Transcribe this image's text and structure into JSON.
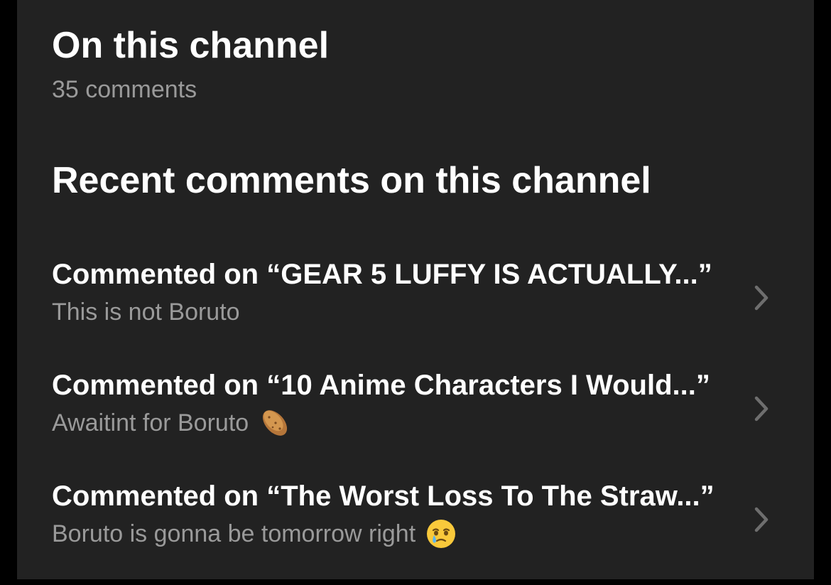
{
  "header": {
    "title": "On this channel",
    "comment_count": "35 comments"
  },
  "recent": {
    "title": "Recent comments on this channel",
    "items": [
      {
        "heading": "Commented on “GEAR 5 LUFFY IS ACTUALLY...”",
        "text": "This is not Boruto",
        "emoji": ""
      },
      {
        "heading": "Commented on “10 Anime Characters I Would...”",
        "text": "Awaitint for Boruto",
        "emoji": "potato"
      },
      {
        "heading": "Commented on “The Worst Loss To The Straw...”",
        "text": "Boruto is gonna be tomorrow right",
        "emoji": "face-holding-back-tears"
      }
    ]
  },
  "icons": {
    "row_chevron": "chevron-right-icon"
  },
  "colors": {
    "background": "#222222",
    "outer": "#000000",
    "primary_text": "#ffffff",
    "secondary_text": "#9a9a9a",
    "chevron": "#6e6e6e"
  }
}
